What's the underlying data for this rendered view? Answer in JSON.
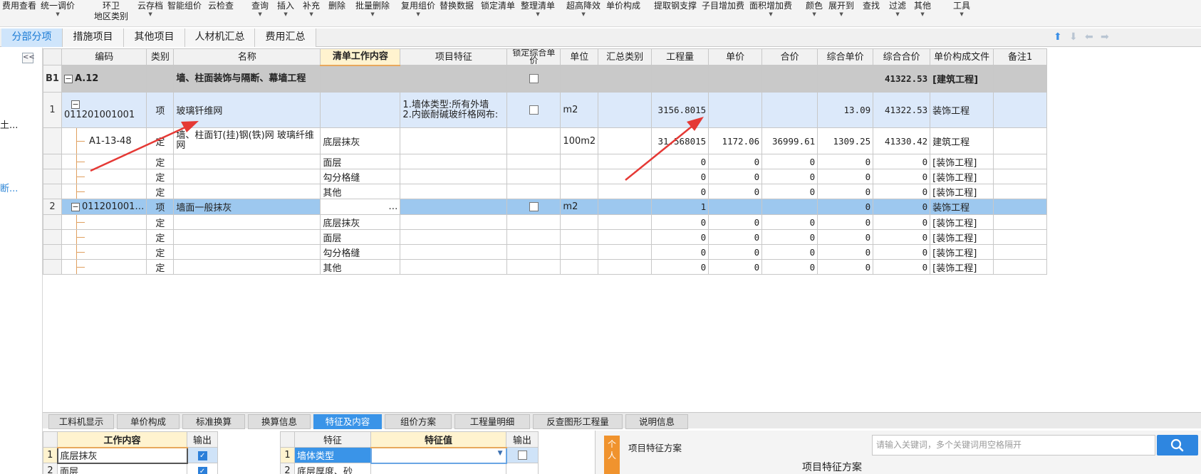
{
  "toolbar": {
    "items": [
      {
        "label": "费用查看",
        "dropdown": false
      },
      {
        "label": "统一调价",
        "dropdown": true
      },
      {
        "label": "环卫",
        "label2": "地区类别",
        "dropdown": false
      },
      {
        "label": "云存档",
        "dropdown": true
      },
      {
        "label": "智能组价",
        "dropdown": false
      },
      {
        "label": "云检查",
        "dropdown": false
      },
      {
        "label": "查询",
        "dropdown": true
      },
      {
        "label": "插入",
        "dropdown": true
      },
      {
        "label": "补充",
        "dropdown": true
      },
      {
        "label": "删除",
        "dropdown": false
      },
      {
        "label": "批量删除",
        "dropdown": true
      },
      {
        "label": "复用组价",
        "dropdown": true
      },
      {
        "label": "替换数据",
        "dropdown": false
      },
      {
        "label": "锁定清单",
        "dropdown": false
      },
      {
        "label": "整理清单",
        "dropdown": true
      },
      {
        "label": "超高降效",
        "dropdown": true
      },
      {
        "label": "单价构成",
        "dropdown": false
      },
      {
        "label": "提取钢支撑",
        "dropdown": false
      },
      {
        "label": "子目增加费",
        "dropdown": false
      },
      {
        "label": "面积增加费",
        "dropdown": true
      },
      {
        "label": "颜色",
        "dropdown": true
      },
      {
        "label": "展开到",
        "dropdown": true
      },
      {
        "label": "查找",
        "dropdown": false
      },
      {
        "label": "过滤",
        "dropdown": true
      },
      {
        "label": "其他",
        "dropdown": true
      },
      {
        "label": "工具",
        "dropdown": true
      }
    ]
  },
  "tabs": [
    {
      "label": "分部分项",
      "active": true
    },
    {
      "label": "措施项目",
      "active": false
    },
    {
      "label": "其他项目",
      "active": false
    },
    {
      "label": "人材机汇总",
      "active": false
    },
    {
      "label": "费用汇总",
      "active": false
    }
  ],
  "left_panel": {
    "collapse_label": "<<",
    "text1": "土...",
    "text2": "断..."
  },
  "grid": {
    "columns": [
      "",
      "编码",
      "类别",
      "名称",
      "清单工作内容",
      "项目特征",
      "锁定综合单价",
      "单位",
      "汇总类别",
      "工程量",
      "单价",
      "合价",
      "综合单价",
      "综合合价",
      "单价构成文件",
      "备注1"
    ],
    "rows": [
      {
        "type": "sect",
        "rn": "B1",
        "code": "A.12",
        "cat": "",
        "name": "墙、柱面装饰与隔断、幕墙工程",
        "work": "",
        "feat": "",
        "lock": true,
        "unit": "",
        "sumcat": "",
        "qty": "",
        "price": "",
        "total": "",
        "uprice": "",
        "utotal": "41322.53",
        "file": "[建筑工程]",
        "note": ""
      },
      {
        "type": "qd",
        "rn": "1",
        "code": "011201001001",
        "cat": "项",
        "name": "玻璃钎维网",
        "work": "",
        "feat": "1.墙体类型:所有外墙\n2.内嵌耐碱玻纤格网布:",
        "lock": true,
        "unit": "m2",
        "sumcat": "",
        "qty": "3156.8015",
        "price": "",
        "total": "",
        "uprice": "13.09",
        "utotal": "41322.53",
        "file": "装饰工程",
        "note": ""
      },
      {
        "type": "de",
        "rn": "",
        "code": "A1-13-48",
        "cat": "定",
        "name": "墙、柱面钉(挂)钢(铁)网 玻璃纤维网",
        "work": "底层抹灰",
        "feat": "",
        "lock": false,
        "unit": "100m2",
        "sumcat": "",
        "qty": "31.568015",
        "price": "1172.06",
        "total": "36999.61",
        "uprice": "1309.25",
        "utotal": "41330.42",
        "file": "建筑工程",
        "note": ""
      },
      {
        "type": "de",
        "rn": "",
        "code": "",
        "cat": "定",
        "name": "",
        "work": "面层",
        "feat": "",
        "lock": false,
        "unit": "",
        "sumcat": "",
        "qty": "0",
        "price": "0",
        "total": "0",
        "uprice": "0",
        "utotal": "0",
        "file": "[装饰工程]",
        "note": ""
      },
      {
        "type": "de",
        "rn": "",
        "code": "",
        "cat": "定",
        "name": "",
        "work": "勾分格缝",
        "feat": "",
        "lock": false,
        "unit": "",
        "sumcat": "",
        "qty": "0",
        "price": "0",
        "total": "0",
        "uprice": "0",
        "utotal": "0",
        "file": "[装饰工程]",
        "note": ""
      },
      {
        "type": "de",
        "rn": "",
        "code": "",
        "cat": "定",
        "name": "",
        "work": "其他",
        "feat": "",
        "lock": false,
        "unit": "",
        "sumcat": "",
        "qty": "0",
        "price": "0",
        "total": "0",
        "uprice": "0",
        "utotal": "0",
        "file": "[装饰工程]",
        "note": ""
      },
      {
        "type": "sel",
        "rn": "2",
        "code": "011201001…",
        "cat": "项",
        "name": "墙面一般抹灰",
        "work": "…",
        "feat": "",
        "lock": true,
        "unit": "m2",
        "sumcat": "",
        "qty": "1",
        "price": "",
        "total": "",
        "uprice": "0",
        "utotal": "0",
        "file": "装饰工程",
        "note": ""
      },
      {
        "type": "de",
        "rn": "",
        "code": "",
        "cat": "定",
        "name": "",
        "work": "底层抹灰",
        "feat": "",
        "lock": false,
        "unit": "",
        "sumcat": "",
        "qty": "0",
        "price": "0",
        "total": "0",
        "uprice": "0",
        "utotal": "0",
        "file": "[装饰工程]",
        "note": ""
      },
      {
        "type": "de",
        "rn": "",
        "code": "",
        "cat": "定",
        "name": "",
        "work": "面层",
        "feat": "",
        "lock": false,
        "unit": "",
        "sumcat": "",
        "qty": "0",
        "price": "0",
        "total": "0",
        "uprice": "0",
        "utotal": "0",
        "file": "[装饰工程]",
        "note": ""
      },
      {
        "type": "de",
        "rn": "",
        "code": "",
        "cat": "定",
        "name": "",
        "work": "勾分格缝",
        "feat": "",
        "lock": false,
        "unit": "",
        "sumcat": "",
        "qty": "0",
        "price": "0",
        "total": "0",
        "uprice": "0",
        "utotal": "0",
        "file": "[装饰工程]",
        "note": ""
      },
      {
        "type": "de",
        "rn": "",
        "code": "",
        "cat": "定",
        "name": "",
        "work": "其他",
        "feat": "",
        "lock": false,
        "unit": "",
        "sumcat": "",
        "qty": "0",
        "price": "0",
        "total": "0",
        "uprice": "0",
        "utotal": "0",
        "file": "[装饰工程]",
        "note": ""
      }
    ]
  },
  "bottom_tabs": [
    {
      "label": "工料机显示",
      "active": false
    },
    {
      "label": "单价构成",
      "active": false
    },
    {
      "label": "标准换算",
      "active": false
    },
    {
      "label": "换算信息",
      "active": false
    },
    {
      "label": "特征及内容",
      "active": true
    },
    {
      "label": "组价方案",
      "active": false
    },
    {
      "label": "工程量明细",
      "active": false
    },
    {
      "label": "反查图形工程量",
      "active": false
    },
    {
      "label": "说明信息",
      "active": false
    }
  ],
  "work_pane": {
    "headers": [
      "",
      "工作内容",
      "输出"
    ],
    "rows": [
      {
        "rn": "1",
        "content": "底层抹灰",
        "output": true
      },
      {
        "rn": "2",
        "content": "面层",
        "output": true
      }
    ]
  },
  "feature_pane": {
    "headers": [
      "",
      "特征",
      "特征值",
      "输出"
    ],
    "rows": [
      {
        "rn": "1",
        "feature": "墙体类型",
        "value": "",
        "output": false
      },
      {
        "rn": "2",
        "feature": "底层厚度、砂",
        "value": "",
        "output": false
      }
    ]
  },
  "right_pane": {
    "personal_tag": "个人",
    "scheme_label": "项目特征方案",
    "search_placeholder": "请输入关键词，多个关键词用空格隔开",
    "scheme_title": "项目特征方案"
  },
  "colors": {
    "accent": "#3a94e8",
    "section_row": "#c9c9c9",
    "selected_row": "#9dc8ef",
    "annotation_arrow": "#e53935"
  }
}
